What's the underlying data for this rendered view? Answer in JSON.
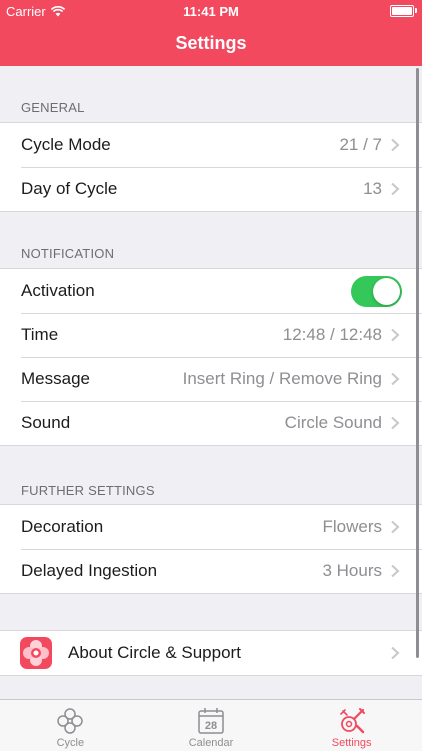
{
  "status_bar": {
    "carrier": "Carrier",
    "time": "11:41 PM"
  },
  "header": {
    "title": "Settings"
  },
  "sections": {
    "general": {
      "title": "GENERAL",
      "cycle_mode": {
        "label": "Cycle Mode",
        "value": "21 / 7"
      },
      "day_of_cycle": {
        "label": "Day of Cycle",
        "value": "13"
      }
    },
    "notification": {
      "title": "NOTIFICATION",
      "activation": {
        "label": "Activation",
        "enabled": true
      },
      "time": {
        "label": "Time",
        "value": "12:48 / 12:48"
      },
      "message": {
        "label": "Message",
        "value": "Insert Ring / Remove Ring"
      },
      "sound": {
        "label": "Sound",
        "value": "Circle Sound"
      }
    },
    "further": {
      "title": "FURTHER SETTINGS",
      "decoration": {
        "label": "Decoration",
        "value": "Flowers"
      },
      "delayed_ingestion": {
        "label": "Delayed Ingestion",
        "value": "3 Hours"
      }
    },
    "about": {
      "label": "About Circle & Support",
      "icon": "flower-app-icon"
    }
  },
  "tabbar": {
    "tabs": [
      {
        "label": "Cycle",
        "icon": "cycle-icon",
        "active": false
      },
      {
        "label": "Calendar",
        "icon": "calendar-icon",
        "day": "28",
        "active": false
      },
      {
        "label": "Settings",
        "icon": "settings-tools-icon",
        "active": true
      }
    ]
  },
  "colors": {
    "accent": "#f2495f",
    "toggle_on": "#34c759",
    "secondary_text": "#8e8e93",
    "background": "#efeff4"
  }
}
